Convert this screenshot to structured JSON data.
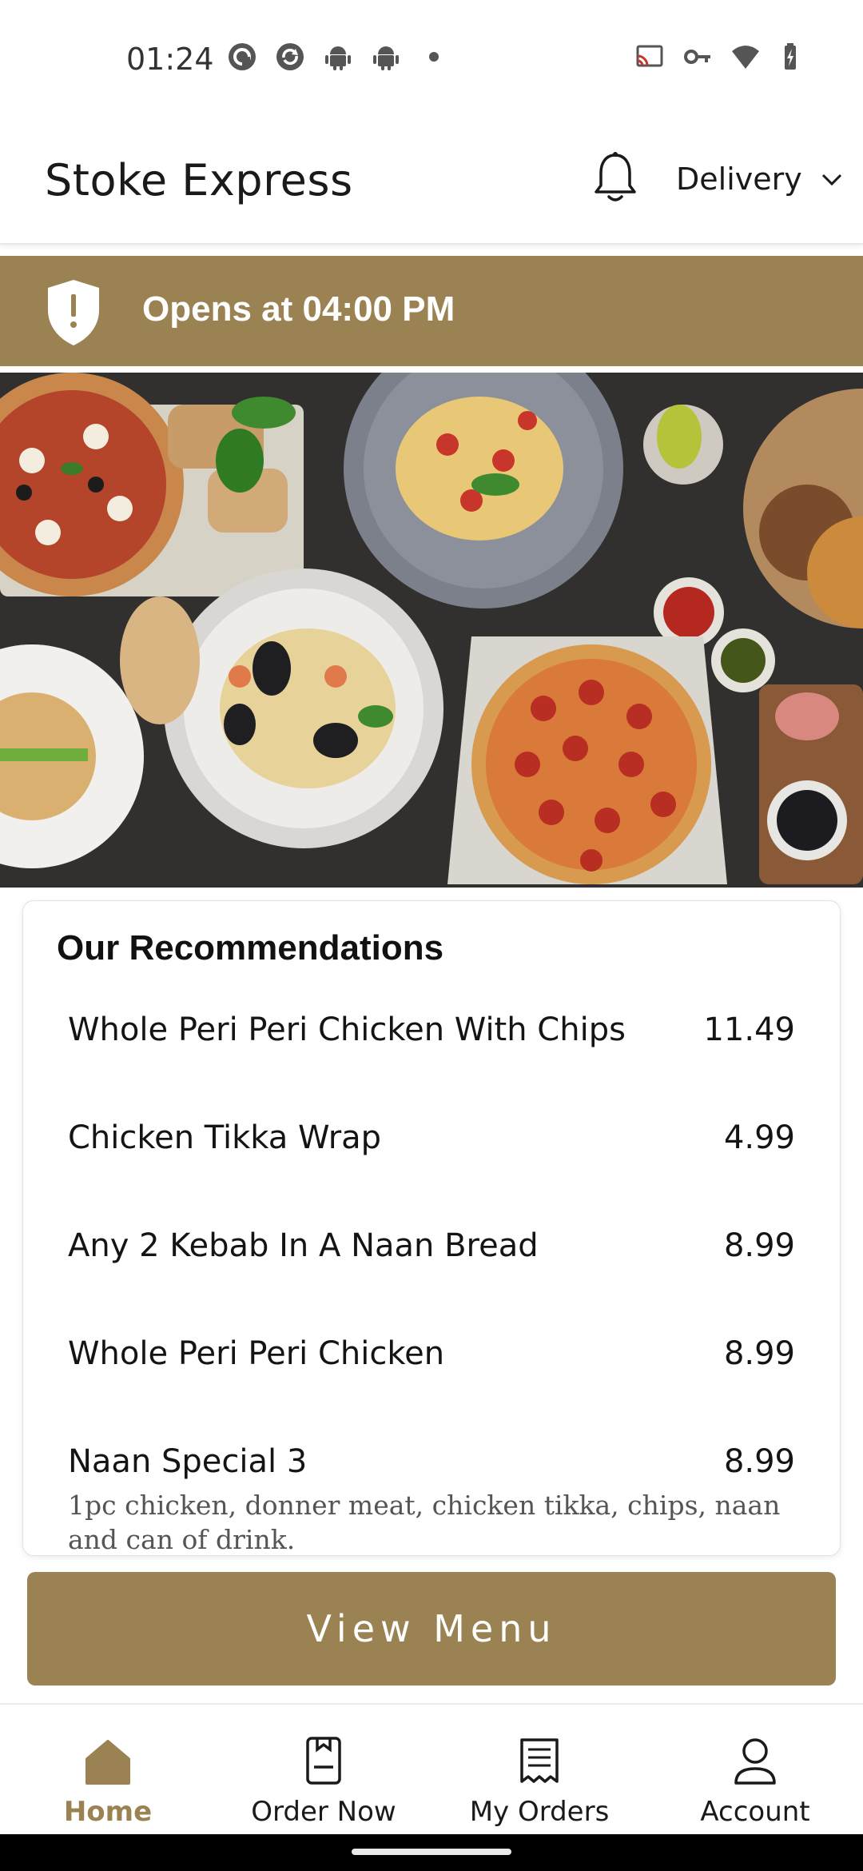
{
  "status_bar": {
    "time": "01:24",
    "left_icons": [
      "pocket-casts-icon",
      "sync-icon",
      "android-icon",
      "android-icon",
      "dot-icon"
    ],
    "right_icons": [
      "cast-icon",
      "vpn-key-icon",
      "wifi-icon",
      "battery-charging-icon"
    ]
  },
  "header": {
    "title": "Stoke Express",
    "notification_icon": "bell-icon",
    "order_mode": "Delivery",
    "order_mode_icon": "chevron-down-icon"
  },
  "notice": {
    "icon": "shield-alert-icon",
    "text": "Opens at 04:00 PM"
  },
  "hero": {
    "image": "food-spread-photo"
  },
  "recommendations": {
    "title": "Our Recommendations",
    "items": [
      {
        "name": "Whole Peri Peri Chicken With Chips",
        "price": "11.49",
        "description": ""
      },
      {
        "name": "Chicken Tikka Wrap",
        "price": "4.99",
        "description": ""
      },
      {
        "name": "Any 2 Kebab In A Naan Bread",
        "price": "8.99",
        "description": ""
      },
      {
        "name": "Whole Peri Peri Chicken",
        "price": "8.99",
        "description": ""
      },
      {
        "name": "Naan Special 3",
        "price": "8.99",
        "description": "1pc chicken, donner meat, chicken tikka, chips, naan and can of drink."
      }
    ]
  },
  "view_menu_label": "View Menu",
  "bottom_nav": {
    "items": [
      {
        "label": "Home",
        "icon": "home-icon",
        "active": true
      },
      {
        "label": "Order Now",
        "icon": "order-book-icon",
        "active": false
      },
      {
        "label": "My Orders",
        "icon": "receipt-icon",
        "active": false
      },
      {
        "label": "Account",
        "icon": "user-icon",
        "active": false
      }
    ]
  },
  "colors": {
    "brand": "#9b8252",
    "text": "#141414",
    "muted": "#555555"
  }
}
